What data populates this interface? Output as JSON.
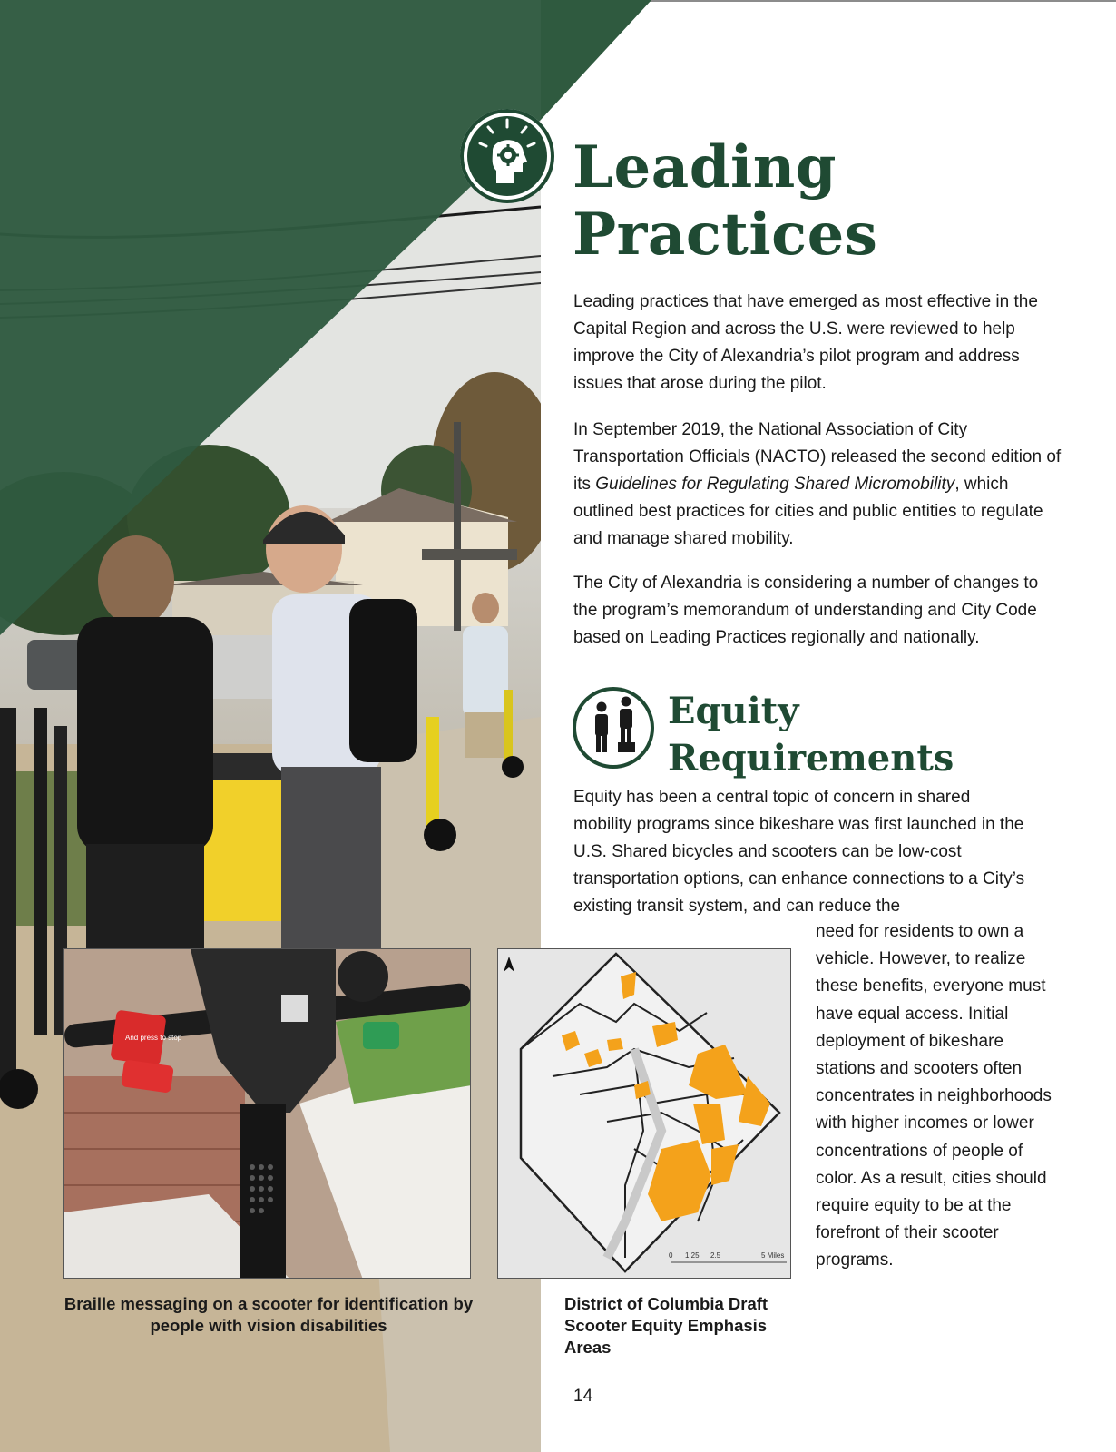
{
  "page": {
    "title": "Leading Practices",
    "title_line1": "Leading",
    "title_line2": "Practices",
    "page_number": "14"
  },
  "intro": {
    "paragraph1": "Leading practices that have emerged as most effective in the Capital Region and across the U.S. were reviewed to help improve the City of Alexandria’s pilot program and address issues that arose during the pilot.",
    "paragraph2_before": "In September 2019, the National Association of City Transportation Officials (NACTO) released the second edition of its ",
    "paragraph2_italic": "Guidelines for Regulating Shared Micromobility",
    "paragraph2_after": ", which outlined best practices for cities and public entities to regulate and manage shared mobility.",
    "paragraph3": "The City of Alexandria is considering a number of changes to the program’s memorandum of understanding and City Code based on Leading Practices regionally and nationally."
  },
  "equity": {
    "title_line1": "Equity",
    "title_line2": "Requirements",
    "paragraph_wide": "Equity has been a central topic of concern in shared mobility programs since bikeshare was first launched in the U.S. Shared bicycles and scooters can be low-cost transportation options, can enhance connections to a City’s existing transit system, and can reduce the",
    "paragraph_narrow": "need for residents to own a vehicle. However, to realize these benefits, everyone must have equal access. Initial deployment of bikeshare stations and scooters often concentrates in neighborhoods with higher incomes or lower concentrations of people of color. As a result, cities should require equity to be at the forefront of their scooter programs."
  },
  "figures": {
    "braille_caption": "Braille messaging on a scooter for identification by people with vision disabilities",
    "map_caption": "District of Columbia Draft Scooter Equity Emphasis Areas",
    "map_scale_labels": [
      "0",
      "1.25",
      "2.5",
      "5 Miles"
    ],
    "scooter_label": "And press to stop"
  },
  "icons": [
    "lightbulb-head-gear-icon",
    "two-people-equity-icon",
    "north-arrow-icon"
  ],
  "colors": {
    "brand_green": "#1f4a33",
    "accent_orange": "#f4a21b",
    "text": "#1a1a1a"
  }
}
